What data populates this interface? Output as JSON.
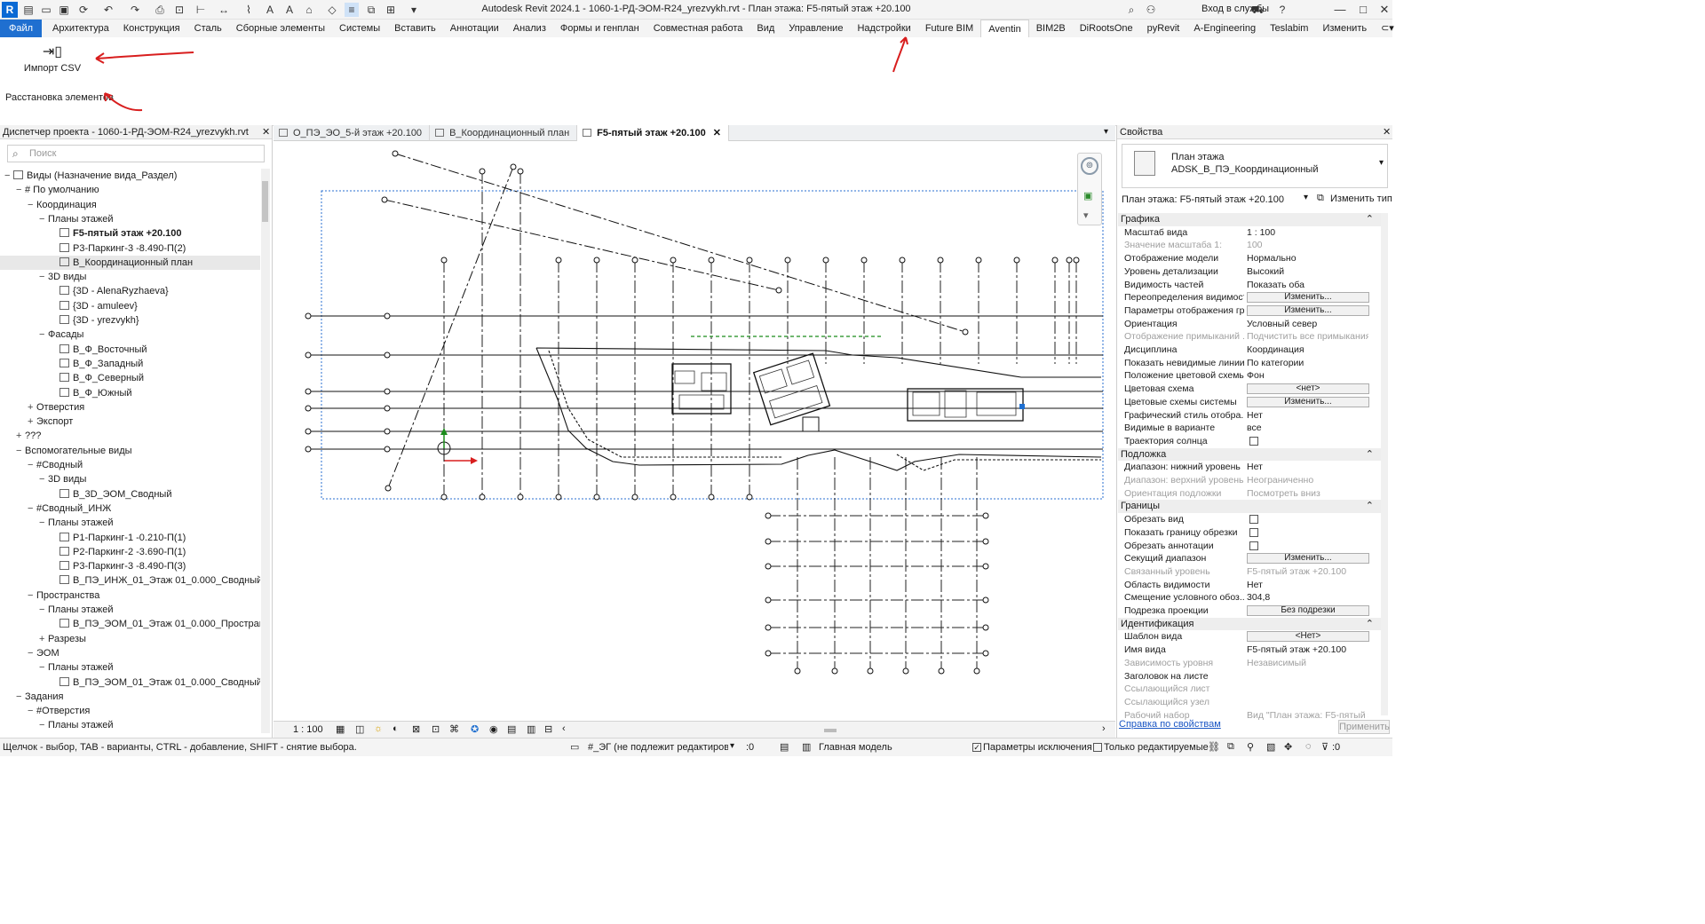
{
  "window": {
    "title": "Autodesk Revit 2024.1 - 1060-1-РД-ЭОМ-R24_yrezvykh.rvt - План этажа: F5-пятый этаж +20.100",
    "login": "Вход в службы"
  },
  "menu": {
    "file": "Файл",
    "tabs": [
      "Архитектура",
      "Конструкция",
      "Сталь",
      "Сборные элементы",
      "Системы",
      "Вставить",
      "Аннотации",
      "Анализ",
      "Формы и генплан",
      "Совместная работа",
      "Вид",
      "Управление",
      "Надстройки",
      "Future BIM",
      "Aventin",
      "BIM2B",
      "DiRootsOne",
      "pyRevit",
      "A-Engineering",
      "Teslabim",
      "Изменить"
    ],
    "active_tab": "Aventin"
  },
  "ribbon": {
    "import_label": "Импорт CSV",
    "panel_label": "Расстановка элементов"
  },
  "browser": {
    "title": "Диспетчер проекта - 1060-1-РД-ЭОМ-R24_yrezvykh.rvt",
    "search_placeholder": "Поиск",
    "items": [
      {
        "label": "Виды (Назначение вида_Раздел)",
        "toggle": "−",
        "level": 0,
        "icon": "views"
      },
      {
        "label": "# По умолчанию",
        "toggle": "−",
        "level": 1
      },
      {
        "label": "Координация",
        "toggle": "−",
        "level": 2
      },
      {
        "label": "Планы этажей",
        "toggle": "−",
        "level": 3
      },
      {
        "label": "F5-пятый этаж +20.100",
        "level": 4,
        "icon": "view",
        "bold": true
      },
      {
        "label": "Р3-Паркинг-3 -8.490-П(2)",
        "level": 4,
        "icon": "view"
      },
      {
        "label": "В_Координационный план",
        "level": 4,
        "icon": "view",
        "selected": true
      },
      {
        "label": "3D виды",
        "toggle": "−",
        "level": 3
      },
      {
        "label": "{3D - AlenaRyzhaeva}",
        "level": 4,
        "icon": "view"
      },
      {
        "label": "{3D - amuleev}",
        "level": 4,
        "icon": "view"
      },
      {
        "label": "{3D - yrezvykh}",
        "level": 4,
        "icon": "view"
      },
      {
        "label": "Фасады",
        "toggle": "−",
        "level": 3
      },
      {
        "label": "В_Ф_Восточный",
        "level": 4,
        "icon": "view"
      },
      {
        "label": "В_Ф_Западный",
        "level": 4,
        "icon": "view"
      },
      {
        "label": "В_Ф_Северный",
        "level": 4,
        "icon": "view"
      },
      {
        "label": "В_Ф_Южный",
        "level": 4,
        "icon": "view"
      },
      {
        "label": "Отверстия",
        "toggle": "+",
        "level": 2
      },
      {
        "label": "Экспорт",
        "toggle": "+",
        "level": 2
      },
      {
        "label": "???",
        "toggle": "+",
        "level": 1
      },
      {
        "label": "Вспомогательные виды",
        "toggle": "−",
        "level": 1
      },
      {
        "label": "#Сводный",
        "toggle": "−",
        "level": 2
      },
      {
        "label": "3D виды",
        "toggle": "−",
        "level": 3
      },
      {
        "label": "В_3D_ЭОМ_Сводный",
        "level": 4,
        "icon": "view"
      },
      {
        "label": "#Сводный_ИНЖ",
        "toggle": "−",
        "level": 2
      },
      {
        "label": "Планы этажей",
        "toggle": "−",
        "level": 3
      },
      {
        "label": "Р1-Паркинг-1 -0.210-П(1)",
        "level": 4,
        "icon": "view"
      },
      {
        "label": "Р2-Паркинг-2 -3.690-П(1)",
        "level": 4,
        "icon": "view"
      },
      {
        "label": "Р3-Паркинг-3 -8.490-П(3)",
        "level": 4,
        "icon": "view"
      },
      {
        "label": "В_ПЭ_ИНЖ_01_Этаж 01_0.000_Сводный",
        "level": 4,
        "icon": "view"
      },
      {
        "label": "Пространства",
        "toggle": "−",
        "level": 2
      },
      {
        "label": "Планы этажей",
        "toggle": "−",
        "level": 3
      },
      {
        "label": "В_ПЭ_ЭОМ_01_Этаж 01_0.000_Пространства",
        "level": 4,
        "icon": "view"
      },
      {
        "label": "Разрезы",
        "toggle": "+",
        "level": 3
      },
      {
        "label": "ЭОМ",
        "toggle": "−",
        "level": 2
      },
      {
        "label": "Планы этажей",
        "toggle": "−",
        "level": 3
      },
      {
        "label": "В_ПЭ_ЭОМ_01_Этаж 01_0.000_Сводный",
        "level": 4,
        "icon": "view"
      },
      {
        "label": "Задания",
        "toggle": "−",
        "level": 1
      },
      {
        "label": "#Отверстия",
        "toggle": "−",
        "level": 2
      },
      {
        "label": "Планы этажей",
        "toggle": "−",
        "level": 3
      }
    ]
  },
  "doc_tabs": [
    {
      "label": "О_ПЭ_ЭО_5-й этаж +20.100",
      "active": false
    },
    {
      "label": "В_Координационный план",
      "active": false
    },
    {
      "label": "F5-пятый этаж +20.100",
      "active": true
    }
  ],
  "viewbar": {
    "scale": "1 : 100"
  },
  "properties": {
    "title": "Свойства",
    "type_line1": "План этажа",
    "type_line2": "ADSK_В_ПЭ_Координационный",
    "instance": "План этажа: F5-пятый этаж +20.100",
    "edit_type": "Изменить тип",
    "rows": [
      {
        "cat": "Графика"
      },
      {
        "name": "Масштаб вида",
        "value": "1 : 100"
      },
      {
        "name": "Значение масштаба    1:",
        "value": "100",
        "dim": true
      },
      {
        "name": "Отображение модели",
        "value": "Нормально"
      },
      {
        "name": "Уровень детализации",
        "value": "Высокий"
      },
      {
        "name": "Видимость частей",
        "value": "Показать оба"
      },
      {
        "name": "Переопределения видимост...",
        "button": "Изменить..."
      },
      {
        "name": "Параметры отображения гр...",
        "button": "Изменить..."
      },
      {
        "name": "Ориентация",
        "value": "Условный север"
      },
      {
        "name": "Отображение примыканий ...",
        "value": "Подчистить все примыкания...",
        "dim": true
      },
      {
        "name": "Дисциплина",
        "value": "Координация"
      },
      {
        "name": "Показать невидимые линии",
        "value": "По категории"
      },
      {
        "name": "Положение цветовой схемы",
        "value": "Фон"
      },
      {
        "name": "Цветовая схема",
        "button": "<нет>"
      },
      {
        "name": "Цветовые схемы системы",
        "button": "Изменить..."
      },
      {
        "name": "Графический стиль отобра...",
        "value": "Нет"
      },
      {
        "name": "Видимые в варианте",
        "value": "все"
      },
      {
        "name": "Траектория солнца",
        "checkbox": true
      },
      {
        "cat": "Подложка"
      },
      {
        "name": "Диапазон: нижний уровень",
        "value": "Нет"
      },
      {
        "name": "Диапазон: верхний уровень",
        "value": "Неограниченно",
        "dim": true
      },
      {
        "name": "Ориентация подложки",
        "value": "Посмотреть вниз",
        "dim": true
      },
      {
        "cat": "Границы"
      },
      {
        "name": "Обрезать вид",
        "checkbox": true
      },
      {
        "name": "Показать границу обрезки",
        "checkbox": true
      },
      {
        "name": "Обрезать аннотации",
        "checkbox": true
      },
      {
        "name": "Секущий диапазон",
        "button": "Изменить..."
      },
      {
        "name": "Связанный уровень",
        "value": "F5-пятый этаж +20.100",
        "dim": true
      },
      {
        "name": "Область видимости",
        "value": "Нет"
      },
      {
        "name": "Смещение условного обоз...",
        "value": "304,8"
      },
      {
        "name": "Подрезка проекции",
        "button": "Без подрезки"
      },
      {
        "cat": "Идентификация"
      },
      {
        "name": "Шаблон вида",
        "button": "<Нет>"
      },
      {
        "name": "Имя вида",
        "value": "F5-пятый этаж +20.100"
      },
      {
        "name": "Зависимость уровня",
        "value": "Независимый",
        "dim": true
      },
      {
        "name": "Заголовок на листе",
        "value": ""
      },
      {
        "name": "Ссылающийся лист",
        "value": "",
        "dim": true
      },
      {
        "name": "Ссылающийся узел",
        "value": "",
        "dim": true
      },
      {
        "name": "Рабочий набор",
        "value": "Вид \"План этажа: F5-пятый э...",
        "dim": true
      }
    ],
    "help_link": "Справка по свойствам",
    "apply": "Применить"
  },
  "status": {
    "hint": "Щелчок - выбор, TAB - варианты, CTRL - добавление, SHIFT - снятие выбора.",
    "workset": "#_ЭГ (не подлежит редактировани",
    "zero": ":0",
    "model": "Главная модель",
    "exclusions": "Параметры исключения",
    "editable_only": "Только редактируемые",
    "filter_count": ":0"
  },
  "colors": {
    "accent": "#1f6fd0",
    "annotation": "#d81e1e"
  }
}
